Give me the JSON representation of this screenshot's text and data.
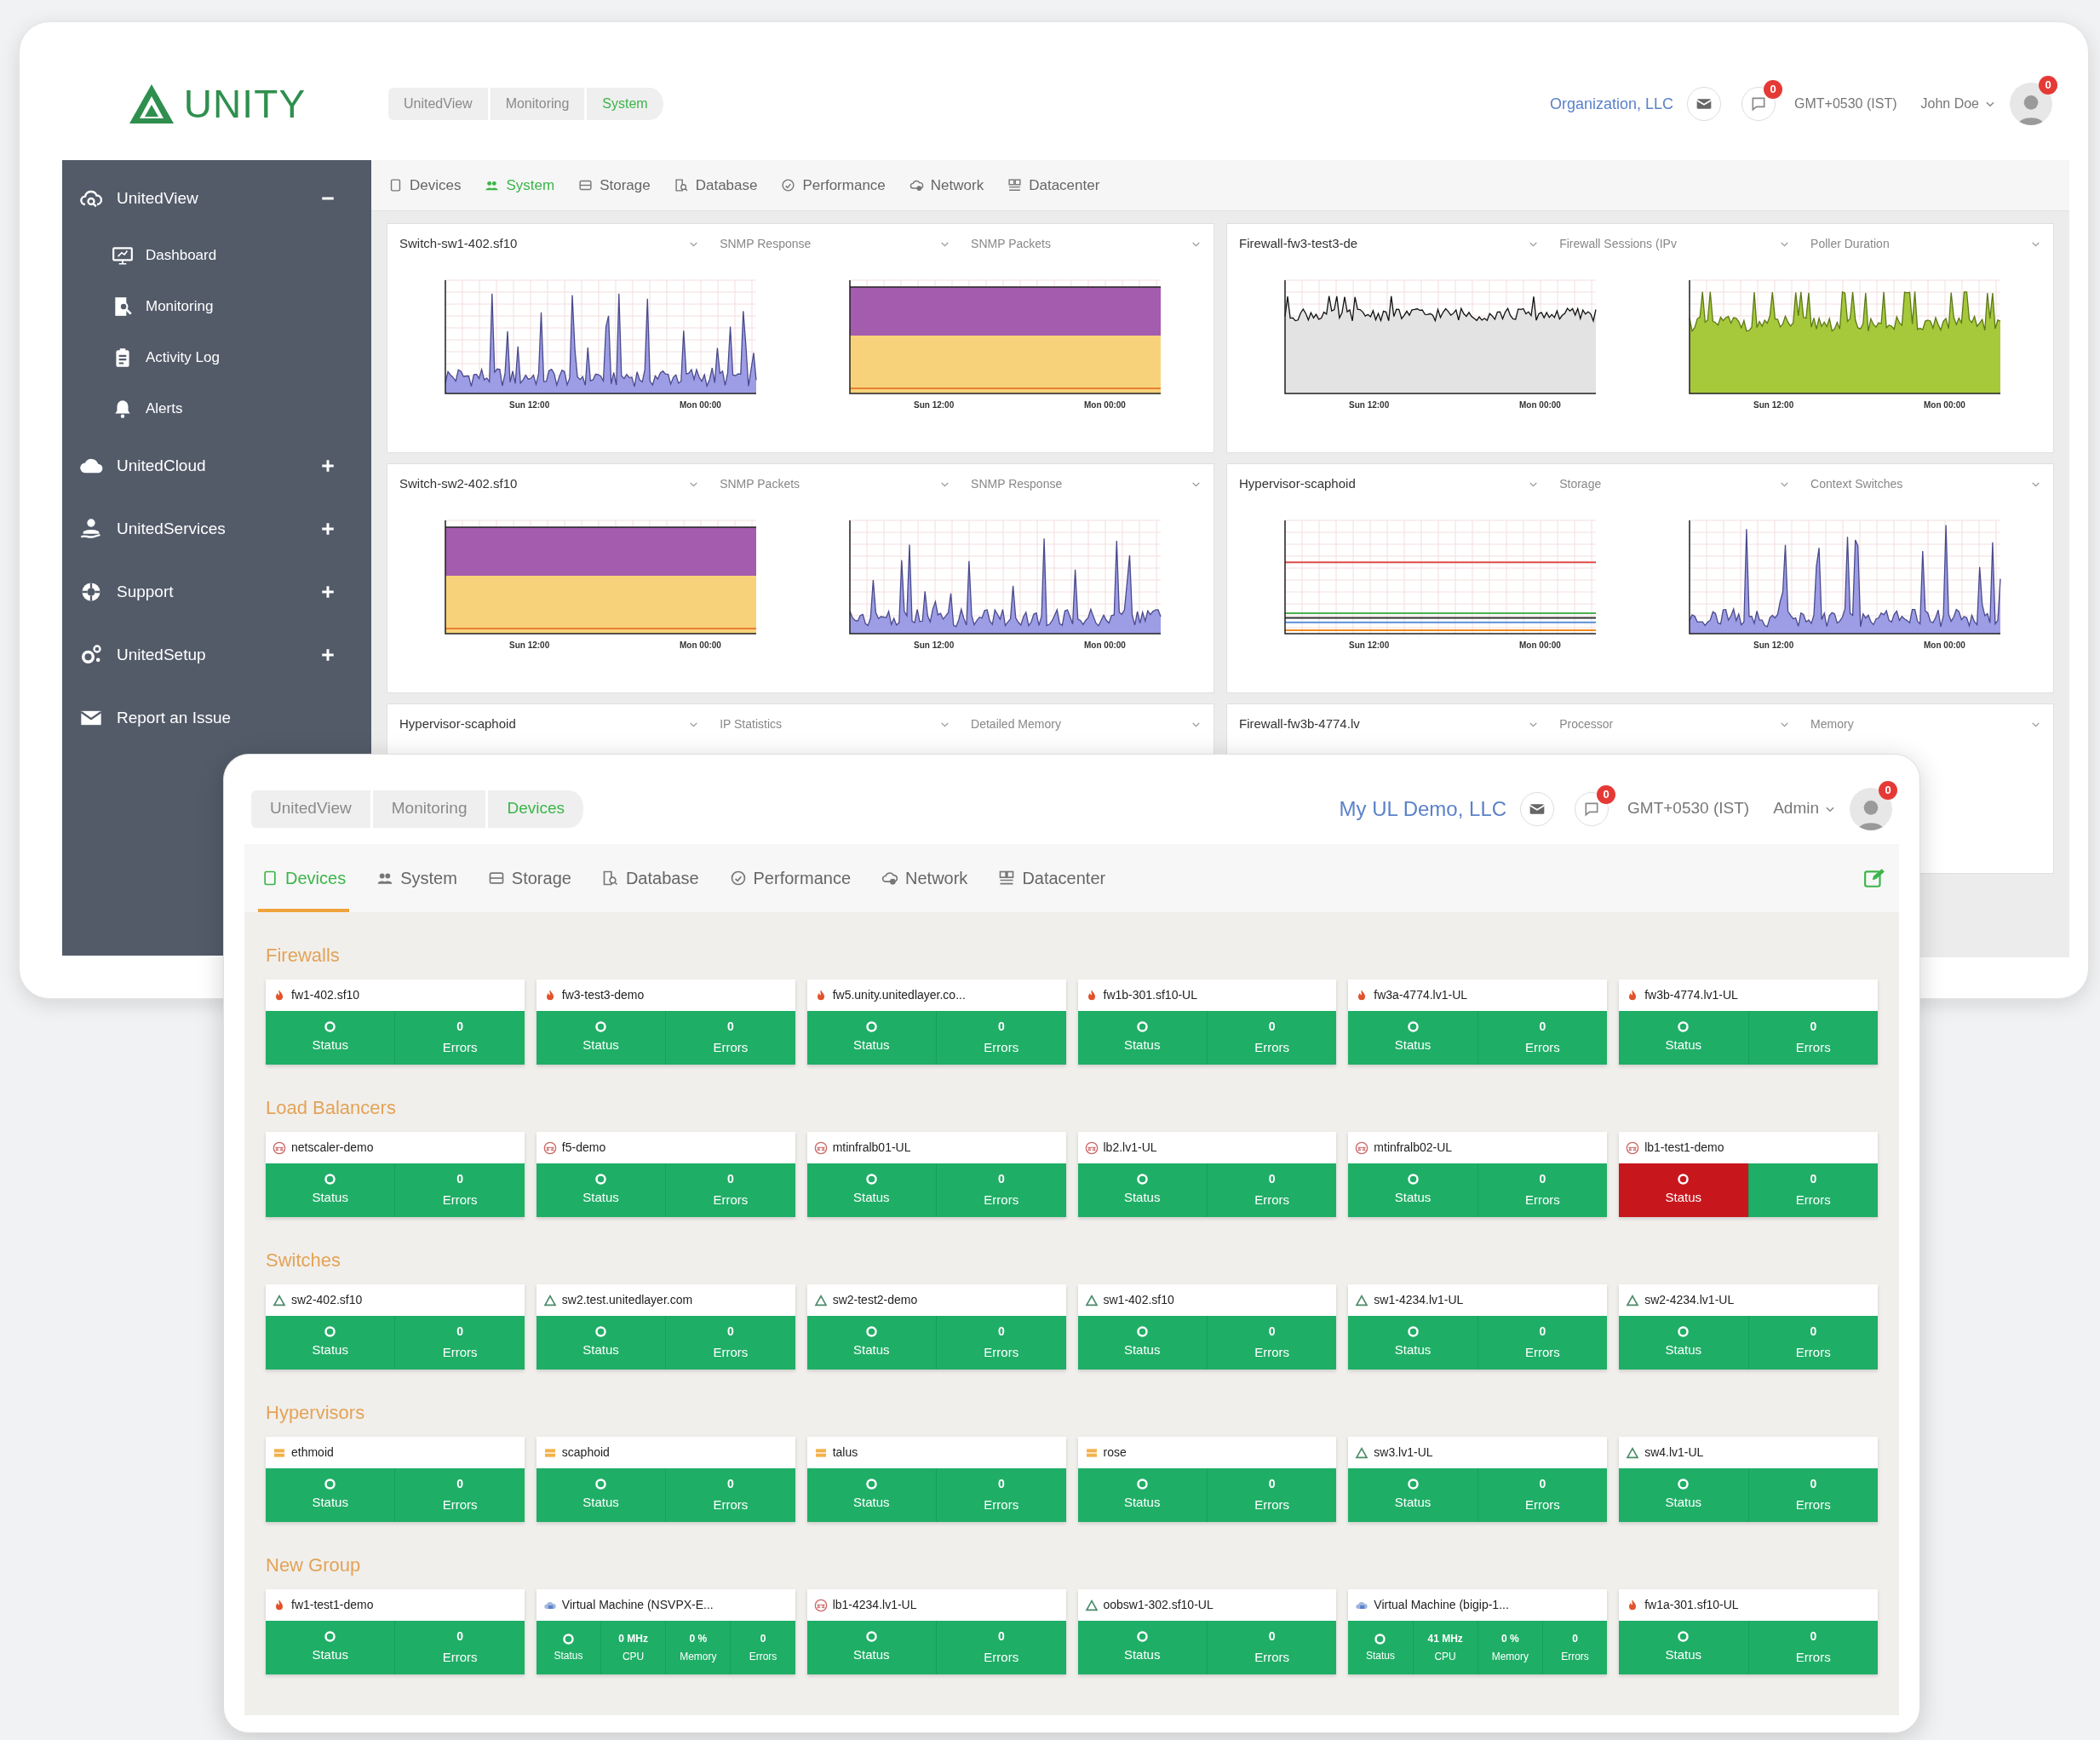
{
  "back_window": {
    "logo": {
      "text": "UNITY"
    },
    "sidebar": {
      "items": [
        {
          "label": "UnitedView",
          "expanded": true,
          "children": [
            {
              "label": "Dashboard"
            },
            {
              "label": "Monitoring"
            },
            {
              "label": "Activity Log"
            },
            {
              "label": "Alerts"
            }
          ]
        },
        {
          "label": "UnitedCloud",
          "expanded": false
        },
        {
          "label": "UnitedServices",
          "expanded": false
        },
        {
          "label": "Support",
          "expanded": false
        },
        {
          "label": "UnitedSetup",
          "expanded": false
        },
        {
          "label": "Report an Issue"
        }
      ]
    },
    "breadcrumb": [
      {
        "label": "UnitedView",
        "current": false
      },
      {
        "label": "Monitoring",
        "current": false
      },
      {
        "label": "System",
        "current": true
      }
    ],
    "organization": "Organization, LLC",
    "chat_badge": "0",
    "timezone": "GMT+0530 (IST)",
    "user": "John Doe",
    "avatar_badge": "0",
    "tabs": [
      {
        "label": "Devices",
        "selected": false
      },
      {
        "label": "System",
        "selected": true
      },
      {
        "label": "Storage",
        "selected": false
      },
      {
        "label": "Database",
        "selected": false
      },
      {
        "label": "Performance",
        "selected": false
      },
      {
        "label": "Network",
        "selected": false
      },
      {
        "label": "Datacenter",
        "selected": false
      }
    ],
    "panels": [
      {
        "selects": [
          "Switch-sw1-402.sf10",
          "SNMP Response",
          "SNMP Packets"
        ],
        "charts": [
          {
            "kind": "spikes",
            "x_labels": [
              "Sun 12:00",
              "Mon 00:00"
            ]
          },
          {
            "kind": "stacked",
            "x_labels": [
              "Sun 12:00",
              "Mon 00:00"
            ]
          }
        ]
      },
      {
        "selects": [
          "Firewall-fw3-test3-de",
          "Firewall Sessions (IPv",
          "Poller Duration"
        ],
        "charts": [
          {
            "kind": "line",
            "x_labels": [
              "Sun 12:00",
              "Mon 00:00"
            ]
          },
          {
            "kind": "green",
            "x_labels": [
              "Sun 12:00",
              "Mon 00:00"
            ]
          }
        ]
      },
      {
        "selects": [
          "Switch-sw2-402.sf10",
          "SNMP Packets",
          "SNMP Response"
        ],
        "charts": [
          {
            "kind": "stacked",
            "x_labels": [
              "Sun 12:00",
              "Mon 00:00"
            ]
          },
          {
            "kind": "spikes",
            "x_labels": [
              "Sun 12:00",
              "Mon 00:00"
            ]
          }
        ]
      },
      {
        "selects": [
          "Hypervisor-scaphoid",
          "Storage",
          "Context Switches"
        ],
        "charts": [
          {
            "kind": "levels",
            "x_labels": [
              "Sun 12:00",
              "Mon 00:00"
            ]
          },
          {
            "kind": "spikes",
            "x_labels": [
              "Sun 12:00",
              "Mon 00:00"
            ]
          }
        ]
      },
      {
        "selects": [
          "Hypervisor-scaphoid",
          "IP Statistics",
          "Detailed Memory"
        ]
      },
      {
        "selects": [
          "Firewall-fw3b-4774.lv",
          "Processor",
          "Memory"
        ]
      }
    ]
  },
  "front_window": {
    "breadcrumb": [
      {
        "label": "UnitedView",
        "current": false
      },
      {
        "label": "Monitoring",
        "current": false
      },
      {
        "label": "Devices",
        "current": true
      }
    ],
    "organization": "My UL Demo, LLC",
    "chat_badge": "0",
    "timezone": "GMT+0530 (IST)",
    "user": "Admin",
    "avatar_badge": "0",
    "tabs": [
      {
        "label": "Devices",
        "selected": true
      },
      {
        "label": "System",
        "selected": false
      },
      {
        "label": "Storage",
        "selected": false
      },
      {
        "label": "Database",
        "selected": false
      },
      {
        "label": "Performance",
        "selected": false
      },
      {
        "label": "Network",
        "selected": false
      },
      {
        "label": "Datacenter",
        "selected": false
      }
    ],
    "groups": [
      {
        "title": "Firewalls",
        "cards": [
          {
            "kind": "firewall",
            "name": "fw1-402.sf10",
            "cells": [
              {
                "kind": "status",
                "label": "Status",
                "alert": false
              },
              {
                "kind": "value",
                "value": "0",
                "label": "Errors"
              }
            ]
          },
          {
            "kind": "firewall",
            "name": "fw3-test3-demo",
            "cells": [
              {
                "kind": "status",
                "label": "Status",
                "alert": false
              },
              {
                "kind": "value",
                "value": "0",
                "label": "Errors"
              }
            ]
          },
          {
            "kind": "firewall",
            "name": "fw5.unity.unitedlayer.co...",
            "cells": [
              {
                "kind": "status",
                "label": "Status",
                "alert": false
              },
              {
                "kind": "value",
                "value": "0",
                "label": "Errors"
              }
            ]
          },
          {
            "kind": "firewall",
            "name": "fw1b-301.sf10-UL",
            "cells": [
              {
                "kind": "status",
                "label": "Status",
                "alert": false
              },
              {
                "kind": "value",
                "value": "0",
                "label": "Errors"
              }
            ]
          },
          {
            "kind": "firewall",
            "name": "fw3a-4774.lv1-UL",
            "cells": [
              {
                "kind": "status",
                "label": "Status",
                "alert": false
              },
              {
                "kind": "value",
                "value": "0",
                "label": "Errors"
              }
            ]
          },
          {
            "kind": "firewall",
            "name": "fw3b-4774.lv1-UL",
            "cells": [
              {
                "kind": "status",
                "label": "Status",
                "alert": false
              },
              {
                "kind": "value",
                "value": "0",
                "label": "Errors"
              }
            ]
          }
        ]
      },
      {
        "title": "Load Balancers",
        "cards": [
          {
            "kind": "load_balancer",
            "name": "netscaler-demo",
            "cells": [
              {
                "kind": "status",
                "label": "Status",
                "alert": false
              },
              {
                "kind": "value",
                "value": "0",
                "label": "Errors"
              }
            ]
          },
          {
            "kind": "load_balancer",
            "name": "f5-demo",
            "cells": [
              {
                "kind": "status",
                "label": "Status",
                "alert": false
              },
              {
                "kind": "value",
                "value": "0",
                "label": "Errors"
              }
            ]
          },
          {
            "kind": "load_balancer",
            "name": "mtinfralb01-UL",
            "cells": [
              {
                "kind": "status",
                "label": "Status",
                "alert": false
              },
              {
                "kind": "value",
                "value": "0",
                "label": "Errors"
              }
            ]
          },
          {
            "kind": "load_balancer",
            "name": "lb2.lv1-UL",
            "cells": [
              {
                "kind": "status",
                "label": "Status",
                "alert": false
              },
              {
                "kind": "value",
                "value": "0",
                "label": "Errors"
              }
            ]
          },
          {
            "kind": "load_balancer",
            "name": "mtinfralb02-UL",
            "cells": [
              {
                "kind": "status",
                "label": "Status",
                "alert": false
              },
              {
                "kind": "value",
                "value": "0",
                "label": "Errors"
              }
            ]
          },
          {
            "kind": "load_balancer",
            "name": "lb1-test1-demo",
            "cells": [
              {
                "kind": "status",
                "label": "Status",
                "alert": true
              },
              {
                "kind": "value",
                "value": "0",
                "label": "Errors"
              }
            ]
          }
        ]
      },
      {
        "title": "Switches",
        "cards": [
          {
            "kind": "switch",
            "name": "sw2-402.sf10",
            "cells": [
              {
                "kind": "status",
                "label": "Status",
                "alert": false
              },
              {
                "kind": "value",
                "value": "0",
                "label": "Errors"
              }
            ]
          },
          {
            "kind": "switch",
            "name": "sw2.test.unitedlayer.com",
            "cells": [
              {
                "kind": "status",
                "label": "Status",
                "alert": false
              },
              {
                "kind": "value",
                "value": "0",
                "label": "Errors"
              }
            ]
          },
          {
            "kind": "switch",
            "name": "sw2-test2-demo",
            "cells": [
              {
                "kind": "status",
                "label": "Status",
                "alert": false
              },
              {
                "kind": "value",
                "value": "0",
                "label": "Errors"
              }
            ]
          },
          {
            "kind": "switch",
            "name": "sw1-402.sf10",
            "cells": [
              {
                "kind": "status",
                "label": "Status",
                "alert": false
              },
              {
                "kind": "value",
                "value": "0",
                "label": "Errors"
              }
            ]
          },
          {
            "kind": "switch",
            "name": "sw1-4234.lv1-UL",
            "cells": [
              {
                "kind": "status",
                "label": "Status",
                "alert": false
              },
              {
                "kind": "value",
                "value": "0",
                "label": "Errors"
              }
            ]
          },
          {
            "kind": "switch",
            "name": "sw2-4234.lv1-UL",
            "cells": [
              {
                "kind": "status",
                "label": "Status",
                "alert": false
              },
              {
                "kind": "value",
                "value": "0",
                "label": "Errors"
              }
            ]
          }
        ]
      },
      {
        "title": "Hypervisors",
        "cards": [
          {
            "kind": "hypervisor",
            "name": "ethmoid",
            "cells": [
              {
                "kind": "status",
                "label": "Status",
                "alert": false
              },
              {
                "kind": "value",
                "value": "0",
                "label": "Errors"
              }
            ]
          },
          {
            "kind": "hypervisor",
            "name": "scaphoid",
            "cells": [
              {
                "kind": "status",
                "label": "Status",
                "alert": false
              },
              {
                "kind": "value",
                "value": "0",
                "label": "Errors"
              }
            ]
          },
          {
            "kind": "hypervisor",
            "name": "talus",
            "cells": [
              {
                "kind": "status",
                "label": "Status",
                "alert": false
              },
              {
                "kind": "value",
                "value": "0",
                "label": "Errors"
              }
            ]
          },
          {
            "kind": "hypervisor",
            "name": "rose",
            "cells": [
              {
                "kind": "status",
                "label": "Status",
                "alert": false
              },
              {
                "kind": "value",
                "value": "0",
                "label": "Errors"
              }
            ]
          },
          {
            "kind": "switch",
            "name": "sw3.lv1-UL",
            "cells": [
              {
                "kind": "status",
                "label": "Status",
                "alert": false
              },
              {
                "kind": "value",
                "value": "0",
                "label": "Errors"
              }
            ]
          },
          {
            "kind": "switch",
            "name": "sw4.lv1-UL",
            "cells": [
              {
                "kind": "status",
                "label": "Status",
                "alert": false
              },
              {
                "kind": "value",
                "value": "0",
                "label": "Errors"
              }
            ]
          }
        ]
      },
      {
        "title": "New Group",
        "cards": [
          {
            "kind": "firewall",
            "name": "fw1-test1-demo",
            "cells": [
              {
                "kind": "status",
                "label": "Status",
                "alert": false
              },
              {
                "kind": "value",
                "value": "0",
                "label": "Errors"
              }
            ]
          },
          {
            "kind": "virtual_machine",
            "name": "Virtual Machine (NSVPX-E...",
            "cells": [
              {
                "kind": "status",
                "label": "Status",
                "alert": false
              },
              {
                "kind": "value",
                "value": "0 MHz",
                "label": "CPU"
              },
              {
                "kind": "value",
                "value": "0 %",
                "label": "Memory"
              },
              {
                "kind": "value",
                "value": "0",
                "label": "Errors"
              }
            ]
          },
          {
            "kind": "load_balancer",
            "name": "lb1-4234.lv1-UL",
            "cells": [
              {
                "kind": "status",
                "label": "Status",
                "alert": false
              },
              {
                "kind": "value",
                "value": "0",
                "label": "Errors"
              }
            ]
          },
          {
            "kind": "switch",
            "name": "oobsw1-302.sf10-UL",
            "cells": [
              {
                "kind": "status",
                "label": "Status",
                "alert": false
              },
              {
                "kind": "value",
                "value": "0",
                "label": "Errors"
              }
            ]
          },
          {
            "kind": "virtual_machine",
            "name": "Virtual Machine (bigip-1...",
            "cells": [
              {
                "kind": "status",
                "label": "Status",
                "alert": false
              },
              {
                "kind": "value",
                "value": "41 MHz",
                "label": "CPU"
              },
              {
                "kind": "value",
                "value": "0 %",
                "label": "Memory"
              },
              {
                "kind": "value",
                "value": "0",
                "label": "Errors"
              }
            ]
          },
          {
            "kind": "firewall",
            "name": "fw1a-301.sf10-UL",
            "cells": [
              {
                "kind": "status",
                "label": "Status",
                "alert": false
              },
              {
                "kind": "value",
                "value": "0",
                "label": "Errors"
              }
            ]
          }
        ]
      }
    ]
  }
}
